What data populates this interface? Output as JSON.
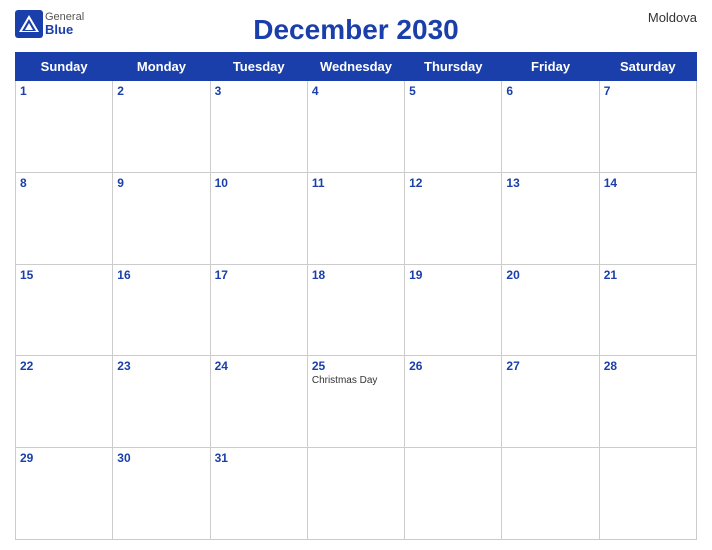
{
  "header": {
    "title": "December 2030",
    "country": "Moldova",
    "logo": {
      "general": "General",
      "blue": "Blue"
    }
  },
  "days_of_week": [
    "Sunday",
    "Monday",
    "Tuesday",
    "Wednesday",
    "Thursday",
    "Friday",
    "Saturday"
  ],
  "weeks": [
    [
      {
        "date": "1",
        "events": []
      },
      {
        "date": "2",
        "events": []
      },
      {
        "date": "3",
        "events": []
      },
      {
        "date": "4",
        "events": []
      },
      {
        "date": "5",
        "events": []
      },
      {
        "date": "6",
        "events": []
      },
      {
        "date": "7",
        "events": []
      }
    ],
    [
      {
        "date": "8",
        "events": []
      },
      {
        "date": "9",
        "events": []
      },
      {
        "date": "10",
        "events": []
      },
      {
        "date": "11",
        "events": []
      },
      {
        "date": "12",
        "events": []
      },
      {
        "date": "13",
        "events": []
      },
      {
        "date": "14",
        "events": []
      }
    ],
    [
      {
        "date": "15",
        "events": []
      },
      {
        "date": "16",
        "events": []
      },
      {
        "date": "17",
        "events": []
      },
      {
        "date": "18",
        "events": []
      },
      {
        "date": "19",
        "events": []
      },
      {
        "date": "20",
        "events": []
      },
      {
        "date": "21",
        "events": []
      }
    ],
    [
      {
        "date": "22",
        "events": []
      },
      {
        "date": "23",
        "events": []
      },
      {
        "date": "24",
        "events": []
      },
      {
        "date": "25",
        "events": [
          "Christmas Day"
        ]
      },
      {
        "date": "26",
        "events": []
      },
      {
        "date": "27",
        "events": []
      },
      {
        "date": "28",
        "events": []
      }
    ],
    [
      {
        "date": "29",
        "events": []
      },
      {
        "date": "30",
        "events": []
      },
      {
        "date": "31",
        "events": []
      },
      {
        "date": "",
        "events": []
      },
      {
        "date": "",
        "events": []
      },
      {
        "date": "",
        "events": []
      },
      {
        "date": "",
        "events": []
      }
    ]
  ],
  "colors": {
    "header_bg": "#1a3faa",
    "header_text": "#ffffff",
    "date_color": "#1a3faa"
  }
}
